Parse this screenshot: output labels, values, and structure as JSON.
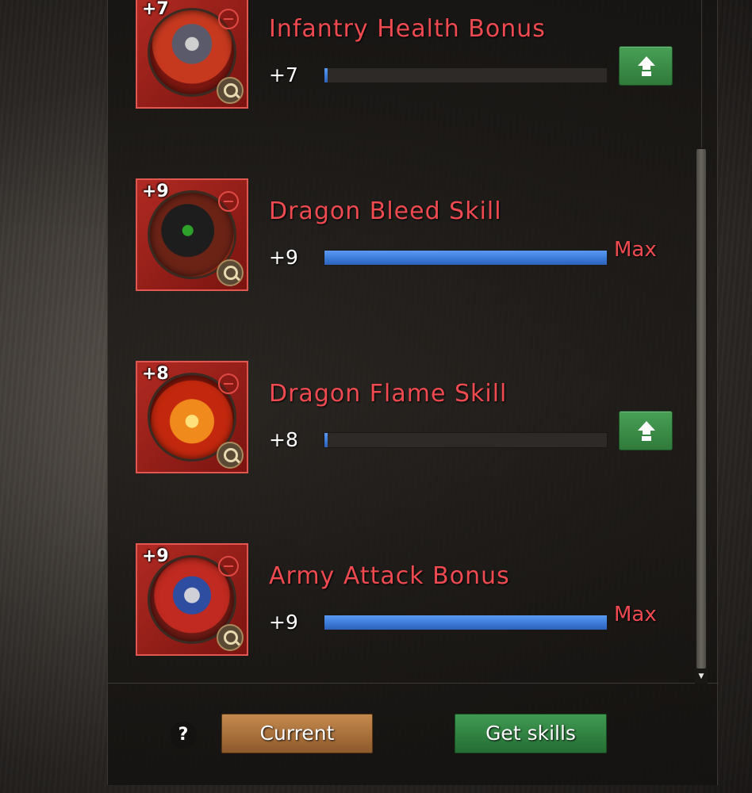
{
  "skills": [
    {
      "badge": "+7",
      "name": "Infantry Health Bonus",
      "level": "+7",
      "progress": 0.01,
      "max_label": "",
      "upgrade_available": true,
      "art": "knight-icon"
    },
    {
      "badge": "+9",
      "name": "Dragon Bleed Skill",
      "level": "+9",
      "progress": 1.0,
      "max_label": "Max",
      "upgrade_available": false,
      "art": "dragon-bleed-icon"
    },
    {
      "badge": "+8",
      "name": "Dragon Flame Skill",
      "level": "+8",
      "progress": 0.01,
      "max_label": "",
      "upgrade_available": true,
      "art": "dragon-flame-icon"
    },
    {
      "badge": "+9",
      "name": "Army Attack Bonus",
      "level": "+9",
      "progress": 1.0,
      "max_label": "Max",
      "upgrade_available": false,
      "art": "army-icon"
    }
  ],
  "footer": {
    "help_label": "?",
    "current_label": "Current",
    "get_skills_label": "Get skills"
  },
  "colors": {
    "skill_name": "#ee4a50",
    "bar_fill": "#3a78d6",
    "upgrade_button": "#2f7a3a",
    "current_button": "#a8703c",
    "get_skills_button": "#2f8a40"
  }
}
